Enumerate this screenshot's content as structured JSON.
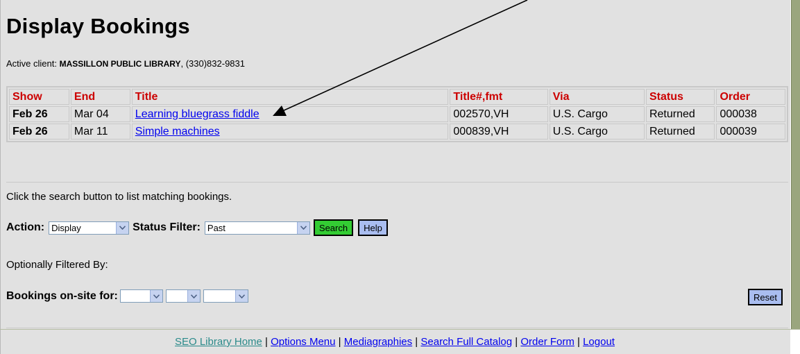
{
  "page": {
    "title": "Display Bookings",
    "client_prefix": "Active client: ",
    "client_name": "MASSILLON PUBLIC LIBRARY",
    "client_phone": ", (330)832-9831"
  },
  "table": {
    "headers": [
      "Show",
      "End",
      "Title",
      "Title#,fmt",
      "Via",
      "Status",
      "Order"
    ],
    "rows": [
      {
        "show": "Feb 26",
        "end": "Mar 04",
        "title": "Learning bluegrass fiddle",
        "title_fmt": "002570,VH",
        "via": "U.S. Cargo",
        "status": "Returned",
        "order": "000038"
      },
      {
        "show": "Feb 26",
        "end": "Mar 11",
        "title": "Simple machines",
        "title_fmt": "000839,VH",
        "via": "U.S. Cargo",
        "status": "Returned",
        "order": "000039"
      }
    ]
  },
  "search": {
    "instructions": "Click the search button to list matching bookings.",
    "action_label": "Action:",
    "action_value": "Display",
    "status_label": "Status Filter:",
    "status_value": "Past",
    "search_button": "Search",
    "help_button": "Help"
  },
  "filters": {
    "optional_label": "Optionally Filtered By:",
    "onsite_label": "Bookings on-site for:",
    "reset_button": "Reset"
  },
  "footer": {
    "links": [
      "SEO Library Home",
      "Options Menu",
      "Mediagraphies",
      "Search Full Catalog",
      "Order Form",
      "Logout"
    ],
    "separator": " | "
  },
  "colors": {
    "panel_bg": "#e1e1e1",
    "header_text": "#cc0000",
    "link": "#0000ee",
    "search_button": "#33cc33",
    "help_button": "#a9bdf0"
  },
  "icons": {
    "dropdown": "chevron-down-icon",
    "annotation": "arrow-icon"
  }
}
